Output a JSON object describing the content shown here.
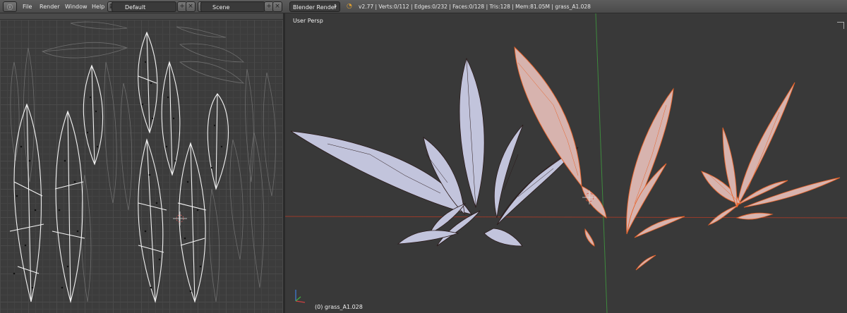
{
  "menubar": {
    "items": [
      "File",
      "Render",
      "Window",
      "Help"
    ],
    "layout": "Default",
    "scene": "Scene",
    "engine": "Blender Render",
    "stats": "v2.77 | Verts:0/112 | Edges:0/232 | Faces:0/128 | Tris:128 | Mem:81.05M | grass_A1.028"
  },
  "viewport": {
    "view_label": "User Persp",
    "object_label": "(0) grass_A1.028"
  },
  "colors": {
    "grid_red": "#9a3a2a",
    "grid_green": "#3e8a3e",
    "selected_edge": "#e8632a",
    "leaf_fill": "#c2c4dc",
    "leaf_fill_selected": "#d7b3ae"
  }
}
